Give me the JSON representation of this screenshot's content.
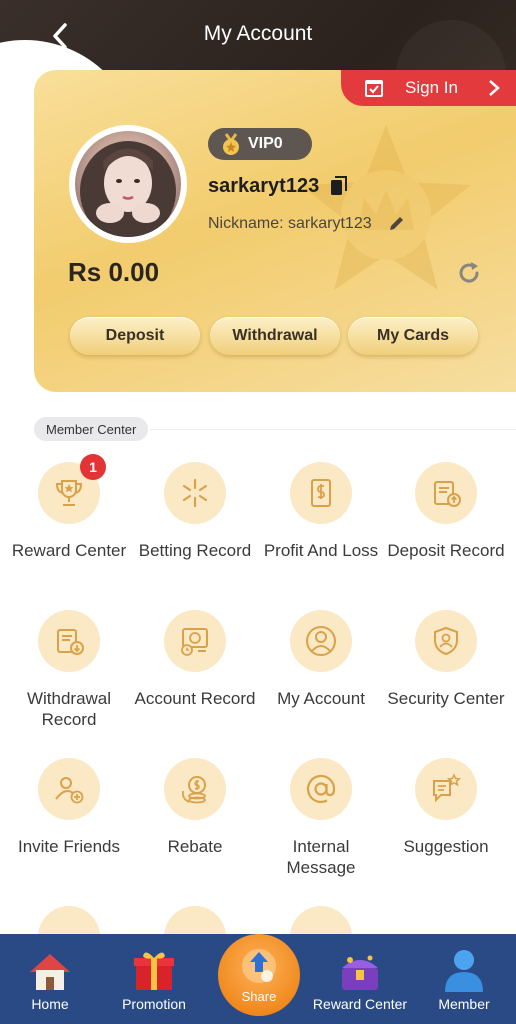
{
  "header": {
    "title": "My Account"
  },
  "card": {
    "sign_in_label": "Sign In",
    "vip_label": "VIP0",
    "username": "sarkaryt123",
    "nickname": "Nickname: sarkaryt123",
    "balance": "Rs 0.00",
    "actions": [
      {
        "label": "Deposit"
      },
      {
        "label": "Withdrawal"
      },
      {
        "label": "My Cards"
      }
    ]
  },
  "member_center": {
    "title": "Member Center",
    "items": [
      {
        "label": "Reward Center",
        "icon": "trophy-icon",
        "badge": "1"
      },
      {
        "label": "Betting Record",
        "icon": "starburst-icon"
      },
      {
        "label": "Profit And Loss",
        "icon": "document-dollar-icon"
      },
      {
        "label": "Deposit Record",
        "icon": "clipboard-upload-icon"
      },
      {
        "label": "Withdrawal Record",
        "icon": "clipboard-download-icon"
      },
      {
        "label": "Account Record",
        "icon": "monitor-clock-icon"
      },
      {
        "label": "My Account",
        "icon": "user-circle-icon"
      },
      {
        "label": "Security Center",
        "icon": "shield-user-icon"
      },
      {
        "label": "Invite Friends",
        "icon": "user-add-icon"
      },
      {
        "label": "Rebate",
        "icon": "coins-icon"
      },
      {
        "label": "Internal Message",
        "icon": "at-icon"
      },
      {
        "label": "Suggestion",
        "icon": "chat-star-icon"
      }
    ]
  },
  "bottom_nav": {
    "items": [
      {
        "label": "Home"
      },
      {
        "label": "Promotion"
      },
      {
        "label": "Share"
      },
      {
        "label": "Reward Center"
      },
      {
        "label": "Member"
      }
    ]
  },
  "colors": {
    "accent": "#e23a3d",
    "gold": "#f2cc6d",
    "nav": "#2a4a86",
    "icon_bg": "#fbe8c4",
    "icon_stroke": "#d9a24a"
  }
}
